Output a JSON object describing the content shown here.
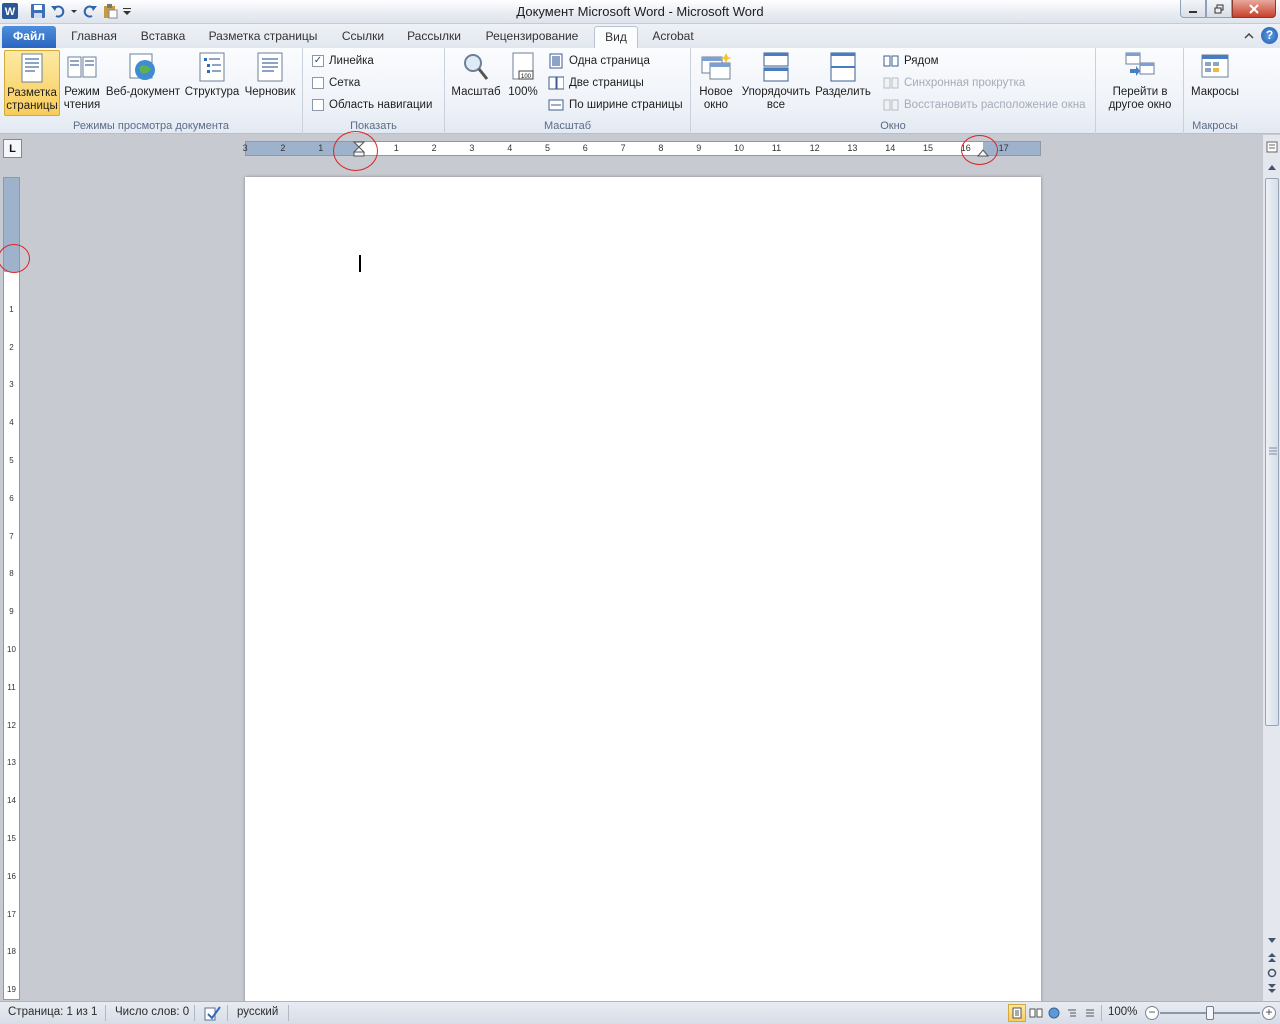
{
  "window": {
    "title": "Документ Microsoft Word  -  Microsoft Word",
    "app_icon": "W"
  },
  "quick_access": [
    "word-app-icon",
    "save-icon",
    "undo-icon",
    "redo-icon",
    "paste-icon",
    "customize-qat-icon"
  ],
  "tabs": {
    "file": "Файл",
    "home": "Главная",
    "insert": "Вставка",
    "page_layout": "Разметка страницы",
    "references": "Ссылки",
    "mailings": "Рассылки",
    "review": "Рецензирование",
    "view": "Вид",
    "acrobat": "Acrobat"
  },
  "ribbon": {
    "views_group": {
      "label": "Режимы просмотра документа",
      "print_layout_1": "Разметка",
      "print_layout_2": "страницы",
      "reading_1": "Режим",
      "reading_2": "чтения",
      "web": "Веб-документ",
      "outline": "Структура",
      "draft": "Черновик"
    },
    "show_group": {
      "label": "Показать",
      "ruler": "Линейка",
      "gridlines": "Сетка",
      "nav_pane": "Область навигации",
      "ruler_checked": "✓"
    },
    "zoom_group": {
      "label": "Масштаб",
      "zoom": "Масштаб",
      "hundred": "100%",
      "one_page": "Одна страница",
      "two_pages": "Две страницы",
      "page_width": "По ширине страницы"
    },
    "window_group": {
      "label": "Окно",
      "new_window_1": "Новое",
      "new_window_2": "окно",
      "arrange_1": "Упорядочить",
      "arrange_2": "все",
      "split": "Разделить",
      "side_by_side": "Рядом",
      "sync_scroll": "Синхронная прокрутка",
      "reset_pos": "Восстановить расположение окна",
      "switch_1": "Перейти в",
      "switch_2": "другое окно"
    },
    "macros_group": {
      "label": "Макросы",
      "macros": "Макросы"
    }
  },
  "ruler": {
    "h_ticks": [
      "3",
      "2",
      "1",
      "1",
      "2",
      "3",
      "4",
      "5",
      "6",
      "7",
      "8",
      "9",
      "10",
      "11",
      "12",
      "13",
      "14",
      "15",
      "16",
      "17"
    ],
    "v_ticks": [
      "1",
      "2",
      "3",
      "4",
      "5",
      "6",
      "7",
      "8",
      "9",
      "10",
      "11",
      "12",
      "13",
      "14",
      "15",
      "16",
      "17",
      "18",
      "19"
    ],
    "tab_selector": "L"
  },
  "status": {
    "page": "Страница: 1 из 1",
    "words": "Число слов: 0",
    "language": "русский",
    "zoom": "100%",
    "zoom_minus": "−",
    "zoom_plus": "+"
  }
}
